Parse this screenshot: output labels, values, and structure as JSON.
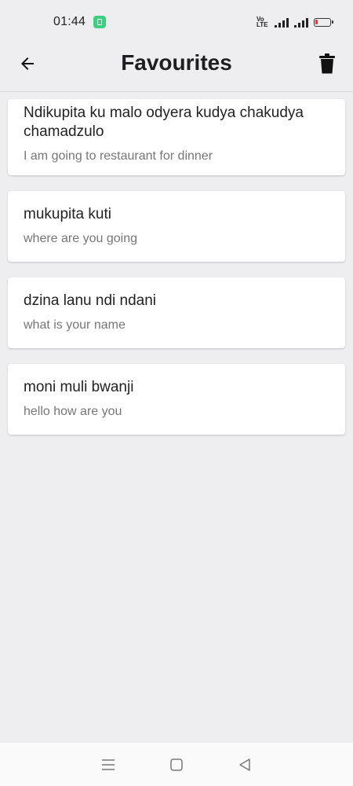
{
  "status_bar": {
    "time": "01:44",
    "network_label": "VoLTE",
    "icons": [
      "app-notification-icon",
      "volte-icon",
      "signal-icon",
      "signal-icon",
      "battery-icon"
    ],
    "battery_color": "#e53935"
  },
  "header": {
    "title": "Favourites",
    "back_icon": "arrow-left-icon",
    "delete_icon": "trash-icon"
  },
  "favourites": [
    {
      "phrase": "Ndikupita ku malo odyera kudya chakudya chamadzulo",
      "translation": "I am going to restaurant for dinner"
    },
    {
      "phrase": "mukupita kuti",
      "translation": "where are you going"
    },
    {
      "phrase": "dzina lanu ndi ndani",
      "translation": "what is your name"
    },
    {
      "phrase": "moni muli bwanji",
      "translation": "hello how are you"
    }
  ],
  "nav_bar": {
    "icons": [
      "menu-icon",
      "home-icon",
      "back-triangle-icon"
    ]
  }
}
